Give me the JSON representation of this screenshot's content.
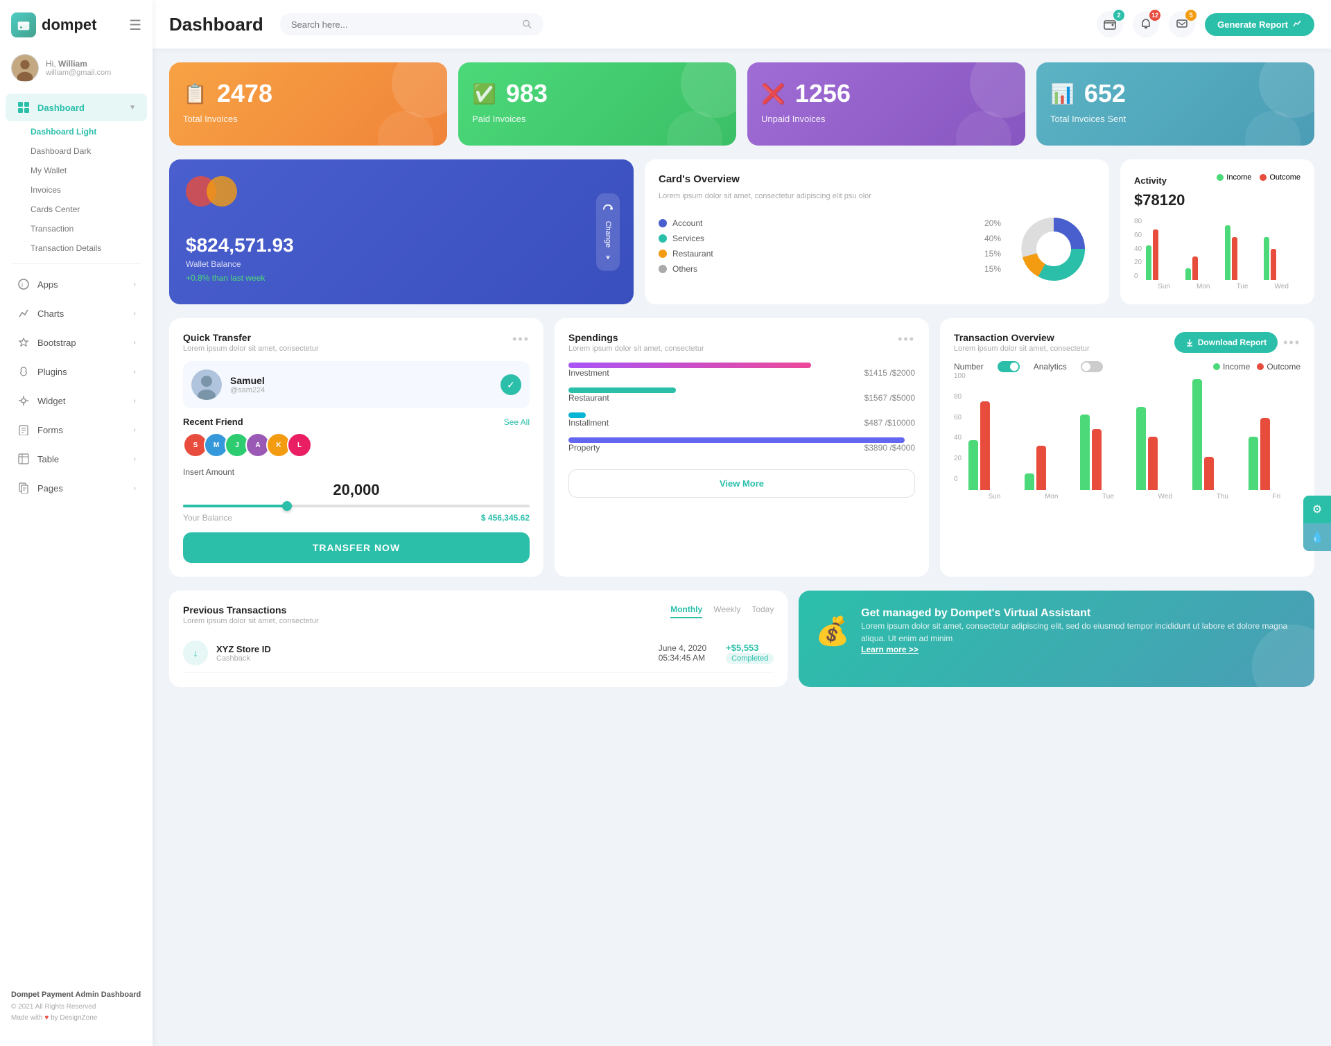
{
  "app": {
    "logo_text": "dompet",
    "title": "Dashboard"
  },
  "topbar": {
    "search_placeholder": "Search here...",
    "generate_btn": "Generate Report",
    "badges": {
      "wallet": "2",
      "notifications": "12",
      "messages": "5"
    }
  },
  "user": {
    "greeting": "Hi,",
    "name": "William",
    "email": "william@gmail.com"
  },
  "sidebar": {
    "dashboard_label": "Dashboard",
    "submenu": [
      {
        "label": "Dashboard Light",
        "active": true
      },
      {
        "label": "Dashboard Dark",
        "active": false
      },
      {
        "label": "My Wallet",
        "active": false
      },
      {
        "label": "Invoices",
        "active": false
      },
      {
        "label": "Cards Center",
        "active": false
      },
      {
        "label": "Transaction",
        "active": false
      },
      {
        "label": "Transaction Details",
        "active": false
      }
    ],
    "nav_items": [
      {
        "label": "Apps",
        "icon": "info"
      },
      {
        "label": "Charts",
        "icon": "chart"
      },
      {
        "label": "Bootstrap",
        "icon": "star"
      },
      {
        "label": "Plugins",
        "icon": "heart"
      },
      {
        "label": "Widget",
        "icon": "gear"
      },
      {
        "label": "Forms",
        "icon": "printer"
      },
      {
        "label": "Table",
        "icon": "table"
      },
      {
        "label": "Pages",
        "icon": "page"
      }
    ],
    "footer_company": "Dompet Payment Admin Dashboard",
    "footer_copy": "© 2021 All Rights Reserved",
    "footer_made": "Made with",
    "footer_by": "by DesignZone"
  },
  "stats": [
    {
      "num": "2478",
      "label": "Total Invoices",
      "color": "orange"
    },
    {
      "num": "983",
      "label": "Paid Invoices",
      "color": "green"
    },
    {
      "num": "1256",
      "label": "Unpaid Invoices",
      "color": "purple"
    },
    {
      "num": "652",
      "label": "Total Invoices Sent",
      "color": "teal"
    }
  ],
  "wallet": {
    "amount": "$824,571.93",
    "label": "Wallet Balance",
    "change": "+0.8% than last week",
    "change_btn": "Change"
  },
  "card_overview": {
    "title": "Card's Overview",
    "subtitle": "Lorem ipsum dolor sit amet, consectetur adipiscing elit psu olor",
    "items": [
      {
        "label": "Account",
        "pct": "20%",
        "color": "#4a5fce"
      },
      {
        "label": "Services",
        "pct": "40%",
        "color": "#2bbfaa"
      },
      {
        "label": "Restaurant",
        "pct": "15%",
        "color": "#f39c12"
      },
      {
        "label": "Others",
        "pct": "15%",
        "color": "#aaa"
      }
    ]
  },
  "activity": {
    "title": "Activity",
    "amount": "$78120",
    "legend": [
      {
        "label": "Income",
        "color": "#4cd97a"
      },
      {
        "label": "Outcome",
        "color": "#e74c3c"
      }
    ],
    "bars": [
      {
        "day": "Sun",
        "income": 45,
        "outcome": 65
      },
      {
        "day": "Mon",
        "income": 15,
        "outcome": 30
      },
      {
        "day": "Tue",
        "income": 70,
        "outcome": 55
      },
      {
        "day": "Wed",
        "income": 55,
        "outcome": 40
      }
    ],
    "y_labels": [
      "0",
      "20",
      "40",
      "60",
      "80"
    ]
  },
  "quick_transfer": {
    "title": "Quick Transfer",
    "subtitle": "Lorem ipsum dolor sit amet, consectetur",
    "user": {
      "name": "Samuel",
      "handle": "@sam224"
    },
    "recent_friends_label": "Recent Friend",
    "see_all": "See All",
    "insert_label": "Insert Amount",
    "amount": "20,000",
    "balance_label": "Your Balance",
    "balance": "$ 456,345.62",
    "transfer_btn": "TRANSFER NOW"
  },
  "spendings": {
    "title": "Spendings",
    "subtitle": "Lorem ipsum dolor sit amet, consectetur",
    "items": [
      {
        "label": "Investment",
        "amount": "$1415",
        "total": "$2000",
        "pct": 70,
        "color": "bar-purple"
      },
      {
        "label": "Restaurant",
        "amount": "$1567",
        "total": "$5000",
        "pct": 31,
        "color": "bar-teal2"
      },
      {
        "label": "Installment",
        "amount": "$487",
        "total": "$10000",
        "pct": 5,
        "color": "bar-cyan"
      },
      {
        "label": "Property",
        "amount": "$3890",
        "total": "$4000",
        "pct": 97,
        "color": "bar-indigo"
      }
    ],
    "view_more_btn": "View More"
  },
  "txn_overview": {
    "title": "Transaction Overview",
    "subtitle": "Lorem ipsum dolor sit amet, consectetur",
    "download_btn": "Download Report",
    "toggle_number": "Number",
    "toggle_analytics": "Analytics",
    "legend": [
      {
        "label": "Income",
        "color": "#4cd97a"
      },
      {
        "label": "Outcome",
        "color": "#e74c3c"
      }
    ],
    "bars": [
      {
        "day": "Sun",
        "income": 45,
        "outcome": 80
      },
      {
        "day": "Mon",
        "income": 15,
        "outcome": 40
      },
      {
        "day": "Tue",
        "income": 68,
        "outcome": 55
      },
      {
        "day": "Wed",
        "income": 75,
        "outcome": 48
      },
      {
        "day": "Thu",
        "income": 100,
        "outcome": 30
      },
      {
        "day": "Fri",
        "income": 48,
        "outcome": 65
      }
    ],
    "y_labels": [
      "0",
      "20",
      "40",
      "60",
      "80",
      "100"
    ]
  },
  "prev_transactions": {
    "title": "Previous Transactions",
    "subtitle": "Lorem ipsum dolor sit amet, consectetur",
    "tabs": [
      "Monthly",
      "Weekly",
      "Today"
    ],
    "active_tab": "Monthly",
    "items": [
      {
        "name": "XYZ Store ID",
        "type": "Cashback",
        "date": "June 4, 2020",
        "time": "05:34:45 AM",
        "amount": "+$5,553",
        "status": "Completed"
      }
    ]
  },
  "va_card": {
    "title": "Get managed by Dompet's Virtual Assistant",
    "desc": "Lorem ipsum dolor sit amet, consectetur adipiscing elit, sed do eiusmod tempor incididunt ut labore et dolore magna aliqua. Ut enim ad minim",
    "link": "Learn more >>"
  }
}
